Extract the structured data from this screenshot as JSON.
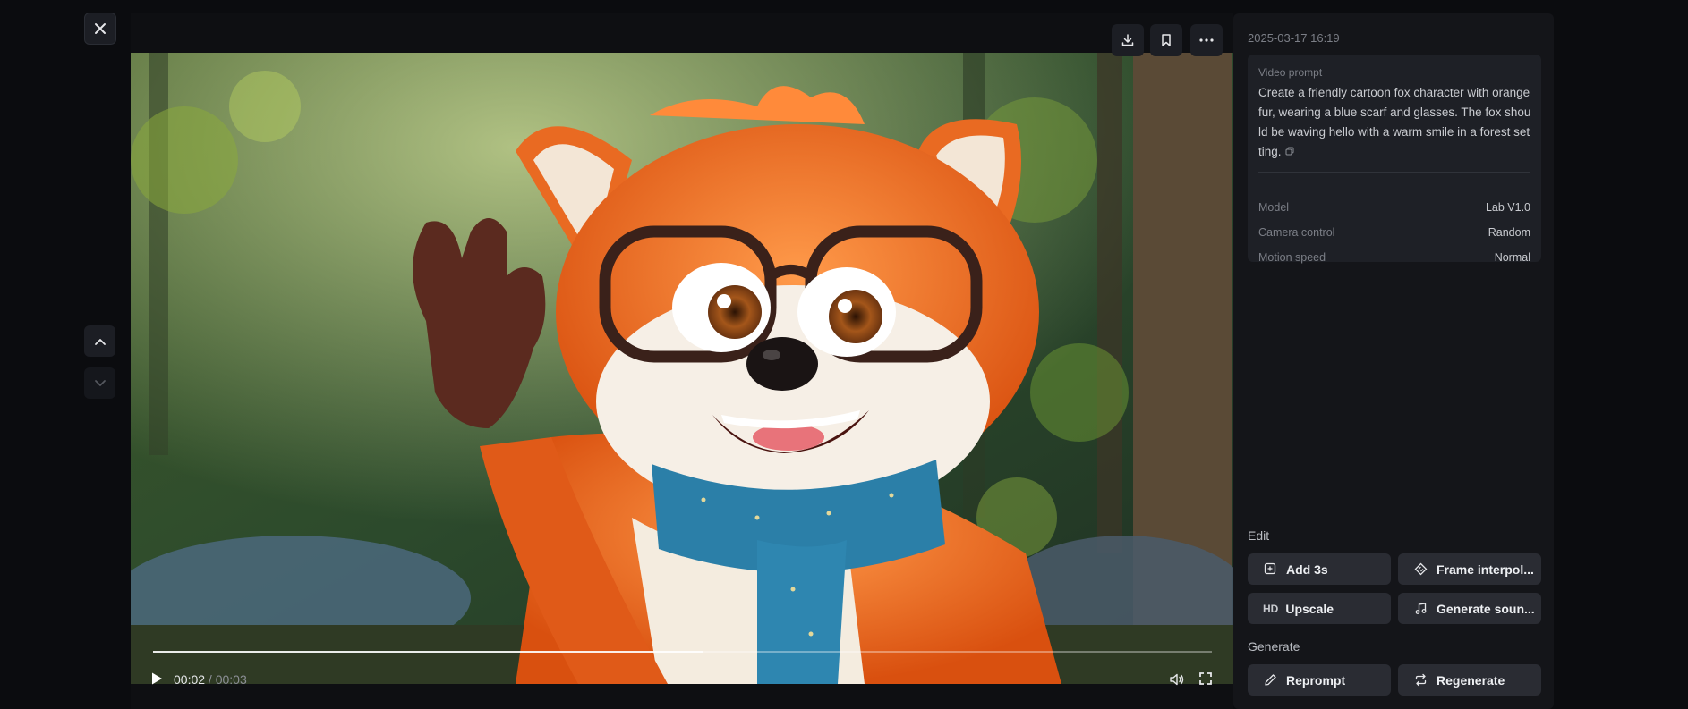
{
  "window": {
    "close_icon": "close-icon",
    "nav_up_icon": "chevron-up-icon",
    "nav_down_icon": "chevron-down-icon"
  },
  "video": {
    "scene": "cartoon fox with glasses and blue scarf waving in forest",
    "top_actions": [
      {
        "icon": "download-icon"
      },
      {
        "icon": "bookmark-icon"
      },
      {
        "icon": "more-icon"
      }
    ],
    "player": {
      "current_time": "00:02",
      "separator": " / ",
      "duration": "00:03",
      "progress": 0.52
    }
  },
  "panel": {
    "timestamp": "2025-03-17 16:19",
    "prompt": {
      "label": "Video prompt",
      "text": "Create a friendly cartoon fox character with orange fur, wearing a blue scarf and glasses. The fox should be waving hello with a warm smile in a forest setting."
    },
    "meta": [
      {
        "key": "Model",
        "value": "Lab V1.0"
      },
      {
        "key": "Camera control",
        "value": "Random"
      },
      {
        "key": "Motion speed",
        "value": "Normal"
      }
    ],
    "edit": {
      "label": "Edit",
      "buttons": [
        {
          "label": "Add 3s",
          "icon": "add-time-icon"
        },
        {
          "label": "Frame interpol...",
          "icon": "frame-interpolation-icon"
        },
        {
          "label": "Upscale",
          "icon": "hd-icon",
          "badge": "HD"
        },
        {
          "label": "Generate soun...",
          "icon": "music-note-icon"
        }
      ]
    },
    "generate": {
      "label": "Generate",
      "buttons": [
        {
          "label": "Reprompt",
          "icon": "pencil-icon"
        },
        {
          "label": "Regenerate",
          "icon": "regenerate-icon"
        }
      ]
    }
  },
  "colors": {
    "background": "#0b0c0f",
    "panel": "#141519",
    "card": "#1e2026",
    "button": "#2a2c33",
    "fox_orange": "#e8641e",
    "scarf_blue": "#2b7fa8"
  }
}
